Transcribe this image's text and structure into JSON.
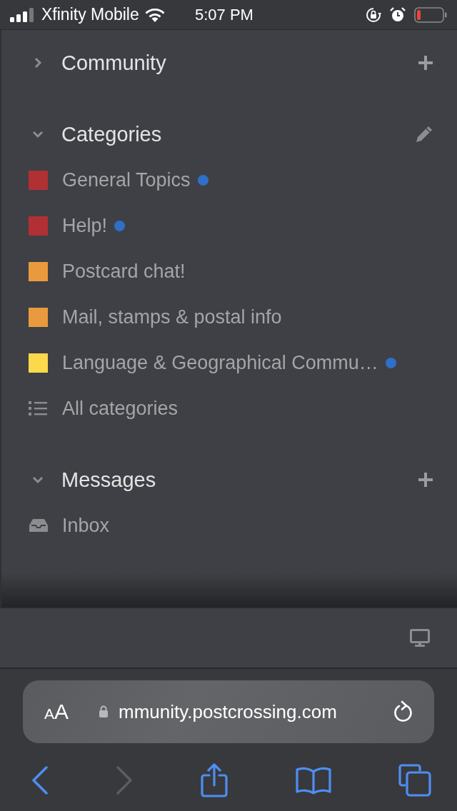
{
  "status_bar": {
    "carrier": "Xfinity Mobile",
    "time": "5:07 PM"
  },
  "sections": [
    {
      "title": "Community",
      "expanded": false,
      "kind": "add"
    },
    {
      "title": "Categories",
      "expanded": true,
      "kind": "edit",
      "items": [
        {
          "kind": "category",
          "label": "General Topics",
          "color": "#b03034",
          "unread": true
        },
        {
          "kind": "category",
          "label": "Help!",
          "color": "#b03034",
          "unread": true
        },
        {
          "kind": "category",
          "label": "Postcard chat!",
          "color": "#e99a3e",
          "unread": false
        },
        {
          "kind": "category",
          "label": "Mail, stamps & postal info",
          "color": "#e99a3e",
          "unread": false
        },
        {
          "kind": "category",
          "label": "Language & Geographical Commu…",
          "color": "#fbd94a",
          "unread": true
        },
        {
          "kind": "all",
          "label": "All categories"
        }
      ]
    },
    {
      "title": "Messages",
      "expanded": true,
      "kind": "add",
      "items": [
        {
          "kind": "inbox",
          "label": "Inbox"
        }
      ]
    }
  ],
  "address_bar": {
    "text_size_label": "AA",
    "url": "mmunity.postcrossing.com"
  },
  "toolbar": [
    {
      "kind": "back",
      "disabled": false
    },
    {
      "kind": "forward",
      "disabled": true
    },
    {
      "kind": "share",
      "disabled": false
    },
    {
      "kind": "bookmarks",
      "disabled": false
    },
    {
      "kind": "tabs",
      "disabled": false
    }
  ]
}
